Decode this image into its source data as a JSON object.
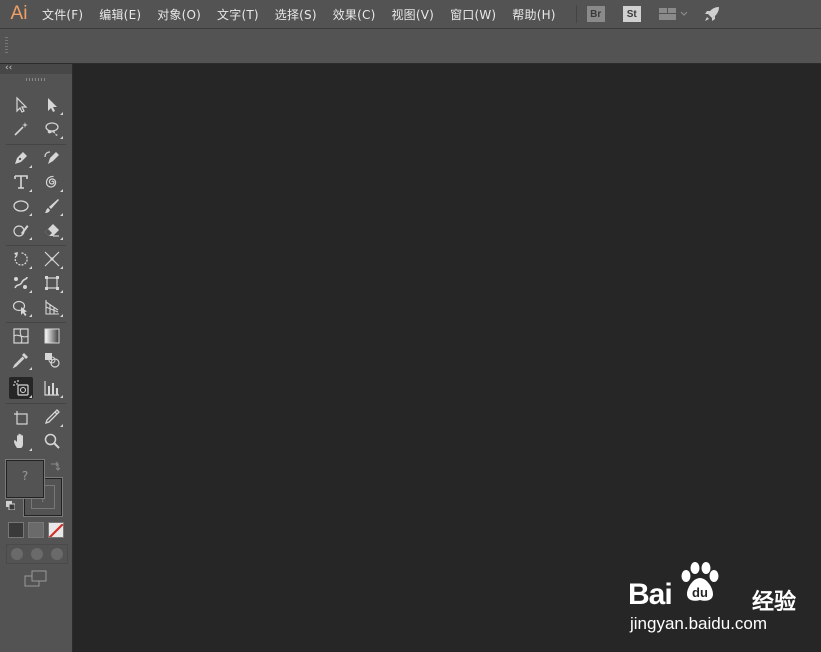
{
  "app": {
    "logo": "Ai"
  },
  "menu": [
    {
      "label": "文件(F)"
    },
    {
      "label": "编辑(E)"
    },
    {
      "label": "对象(O)"
    },
    {
      "label": "文字(T)"
    },
    {
      "label": "选择(S)"
    },
    {
      "label": "效果(C)"
    },
    {
      "label": "视图(V)"
    },
    {
      "label": "窗口(W)"
    },
    {
      "label": "帮助(H)"
    }
  ],
  "app_badges": {
    "bridge": "Br",
    "stock": "St"
  },
  "icons": {
    "workspace": "workspace-layout-icon",
    "rocket": "rocket-icon",
    "tools": [
      "selection-tool-icon",
      "direct-selection-tool-icon",
      "magic-wand-tool-icon",
      "lasso-tool-icon",
      "pen-tool-icon",
      "curvature-tool-icon",
      "type-tool-icon",
      "spiral-tool-icon",
      "ellipse-tool-icon",
      "paintbrush-tool-icon",
      "shaper-tool-icon",
      "eraser-tool-icon",
      "rotate-tool-icon",
      "width-tool-icon",
      "puppet-warp-tool-icon",
      "free-transform-tool-icon",
      "shape-builder-tool-icon",
      "perspective-grid-tool-icon",
      "mesh-tool-icon",
      "gradient-tool-icon",
      "eyedropper-tool-icon",
      "blend-tool-icon",
      "symbol-sprayer-tool-icon",
      "column-graph-tool-icon",
      "artboard-tool-icon",
      "slice-tool-icon",
      "hand-tool-icon",
      "zoom-tool-icon"
    ]
  },
  "toolbox": {
    "collapse": "‹‹",
    "fill_placeholder": "?",
    "stroke_placeholder": "?"
  },
  "colors": {
    "logo": "#f0a064",
    "menubar": "#535353",
    "canvas": "#262626",
    "toolbox": "#535353"
  },
  "watermark": {
    "brand": "Bai",
    "brand_cn": "经验",
    "url": "jingyan.baidu.com"
  }
}
